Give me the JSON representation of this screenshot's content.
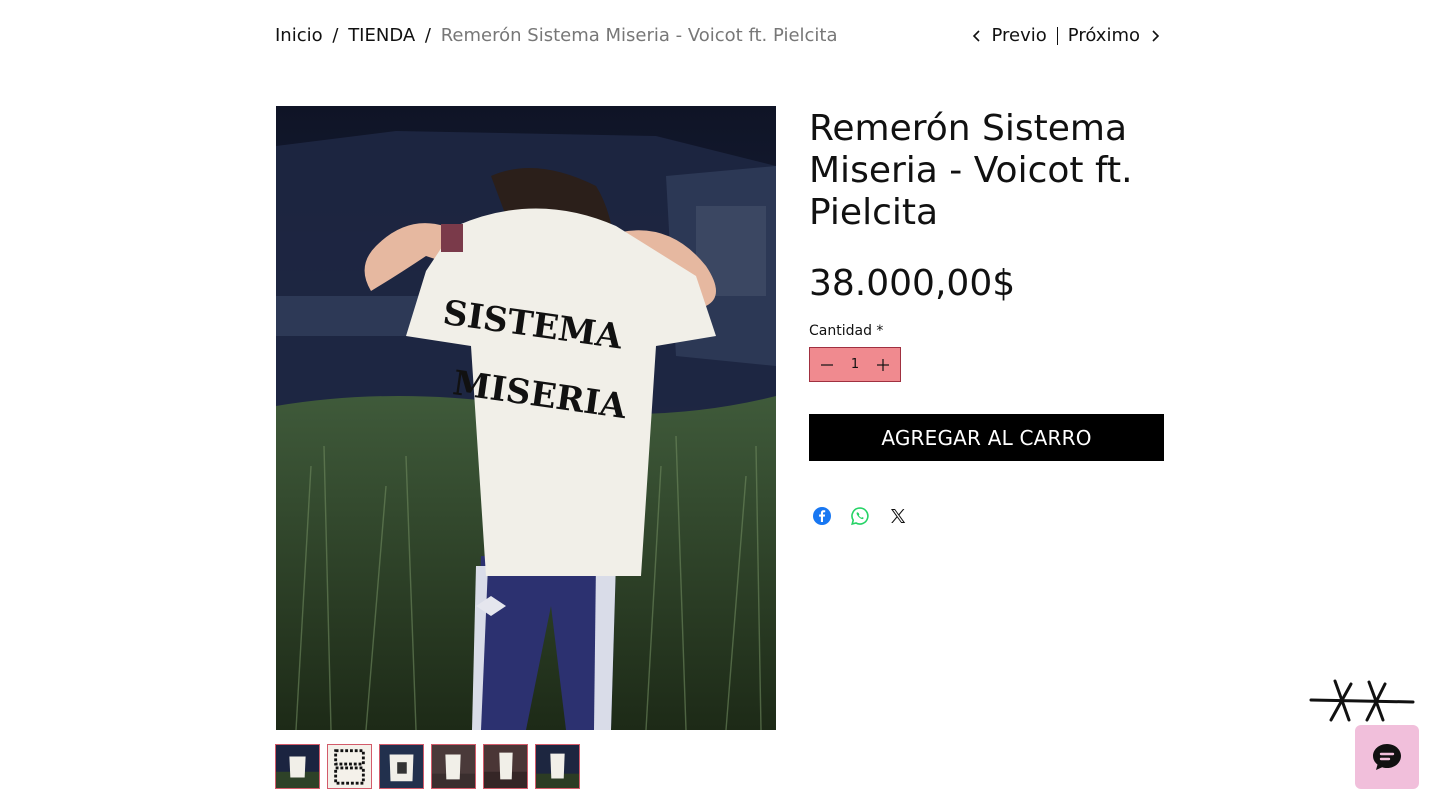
{
  "breadcrumb": {
    "home": "Inicio",
    "separator": "/",
    "category": "TIENDA",
    "current": "Remerón Sistema Miseria - Voicot ft. Pielcita"
  },
  "pager": {
    "prev_label": "Previo",
    "next_label": "Próximo",
    "prev_icon": "chevron-left-icon",
    "next_icon": "chevron-right-icon"
  },
  "product": {
    "title": "Remerón Sistema Miseria - Voicot ft. Pielcita",
    "price": "38.000,00$",
    "print_text_line1": "SISTEMA",
    "print_text_line2": "MISERIA"
  },
  "quantity": {
    "label": "Cantidad *",
    "value": "1",
    "decrease_icon": "minus-icon",
    "increase_icon": "plus-icon"
  },
  "cart": {
    "add_label": "AGREGAR AL CARRO"
  },
  "share": {
    "icons": [
      "facebook-icon",
      "whatsapp-icon",
      "x-twitter-icon"
    ]
  },
  "gallery": {
    "thumb_count": 6,
    "selected_index": 1
  },
  "chat": {
    "icon": "chat-bubble-icon"
  },
  "colors": {
    "qty_bg": "#f08a8f",
    "qty_border": "#a03040",
    "thumb_border": "#d35b6a",
    "button_bg": "#000000",
    "chat_bg": "#f1bfdb",
    "facebook": "#1877f2",
    "whatsapp": "#25d366"
  }
}
